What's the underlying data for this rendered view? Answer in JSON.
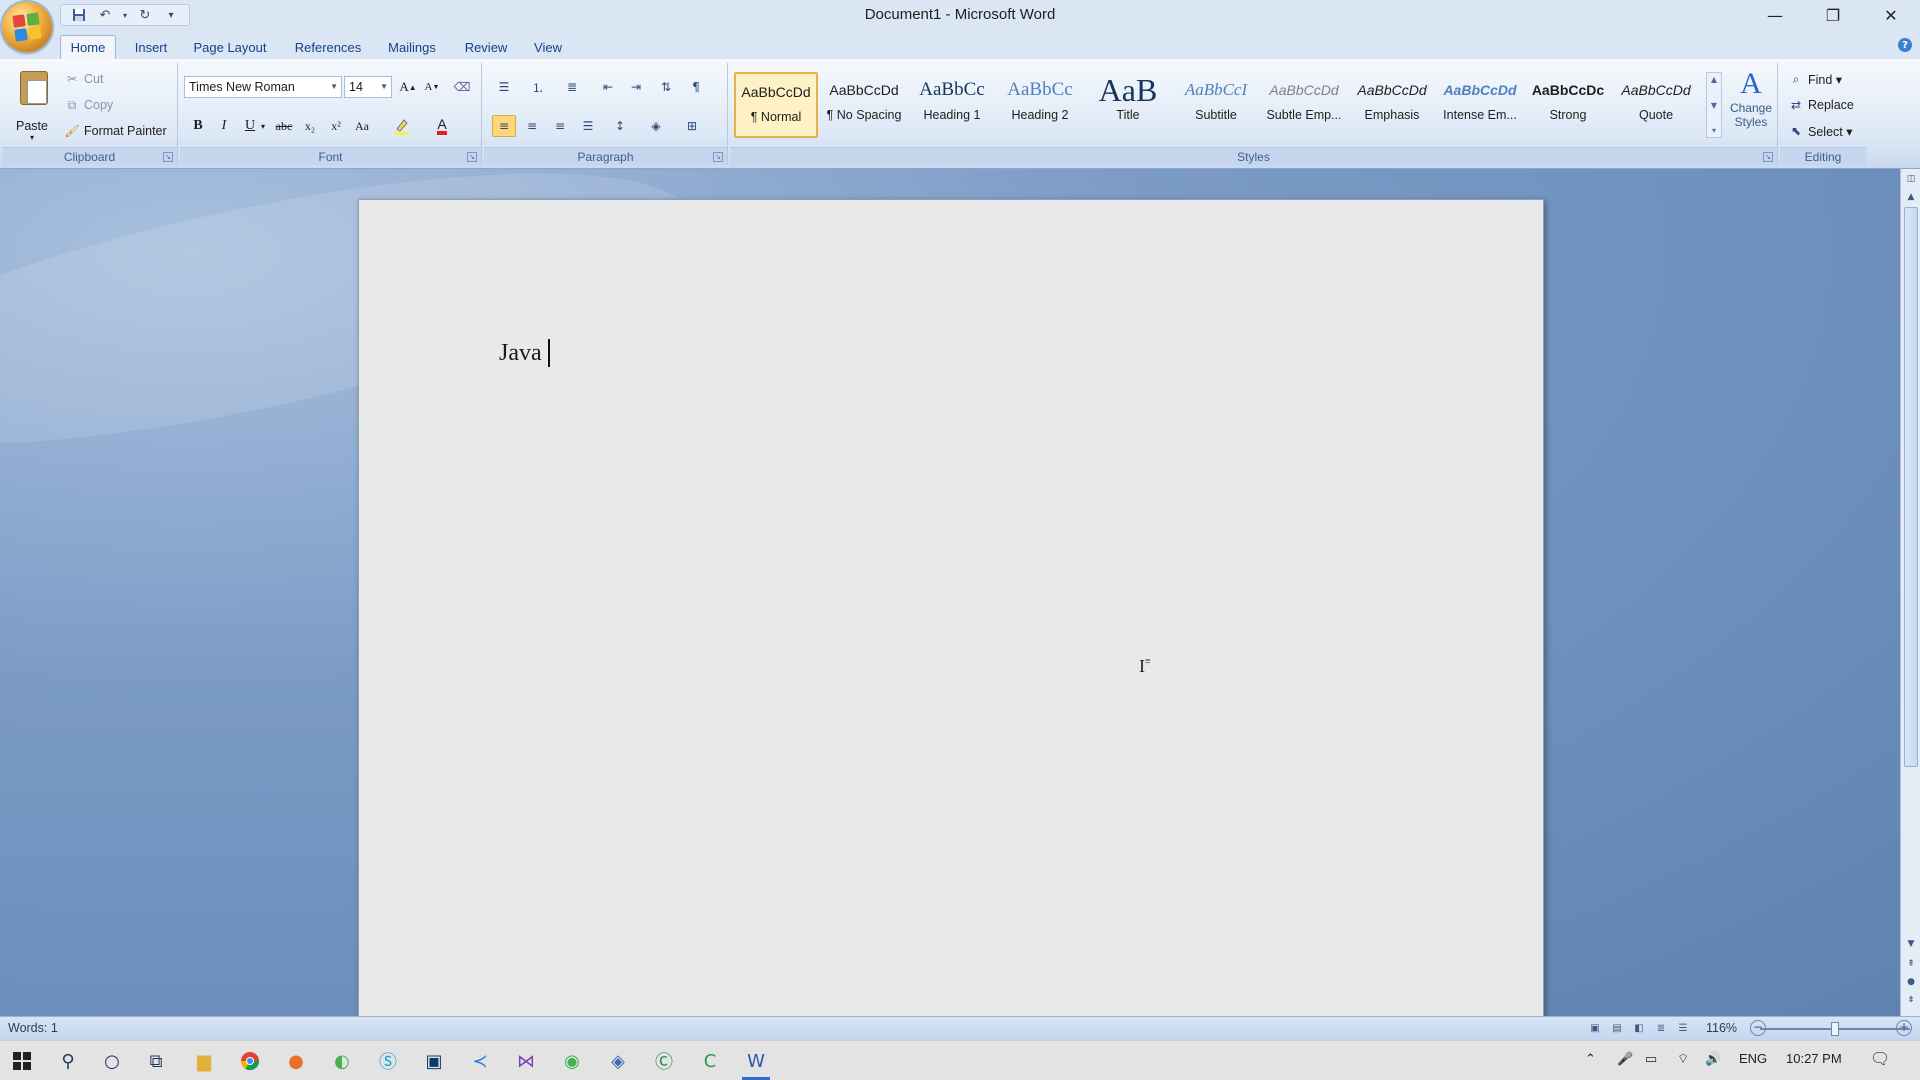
{
  "window": {
    "title": "Document1 - Microsoft Word",
    "controls": {
      "minimize": "—",
      "restore": "❐",
      "close": "✕"
    }
  },
  "quick_access": [
    "save-icon",
    "undo-icon",
    "redo-icon",
    "customize-icon"
  ],
  "tabs": [
    {
      "label": "Home",
      "active": true
    },
    {
      "label": "Insert"
    },
    {
      "label": "Page Layout"
    },
    {
      "label": "References"
    },
    {
      "label": "Mailings"
    },
    {
      "label": "Review"
    },
    {
      "label": "View"
    }
  ],
  "ribbon": {
    "clipboard": {
      "label": "Clipboard",
      "paste": "Paste",
      "cut": "Cut",
      "copy": "Copy",
      "format_painter": "Format Painter"
    },
    "font": {
      "label": "Font",
      "family": "Times New Roman",
      "size": "14",
      "buttons": [
        "B",
        "I",
        "U",
        "abc",
        "x₂",
        "x²",
        "Aa"
      ]
    },
    "paragraph": {
      "label": "Paragraph"
    },
    "styles": {
      "label": "Styles",
      "items": [
        {
          "sample": "AaBbCcDd",
          "name": "¶ Normal",
          "active": true
        },
        {
          "sample": "AaBbCcDd",
          "name": "¶ No Spacing"
        },
        {
          "sample": "AaBbCc",
          "name": "Heading 1"
        },
        {
          "sample": "AaBbCc",
          "name": "Heading 2"
        },
        {
          "sample": "AaB",
          "name": "Title"
        },
        {
          "sample": "AaBbCcI",
          "name": "Subtitle"
        },
        {
          "sample": "AaBbCcDd",
          "name": "Subtle Emp..."
        },
        {
          "sample": "AaBbCcDd",
          "name": "Emphasis"
        },
        {
          "sample": "AaBbCcDd",
          "name": "Intense Em..."
        },
        {
          "sample": "AaBbCcDc",
          "name": "Strong"
        },
        {
          "sample": "AaBbCcDd",
          "name": "Quote"
        }
      ],
      "change_styles_line1": "Change",
      "change_styles_line2": "Styles"
    },
    "editing": {
      "label": "Editing",
      "find": "Find",
      "replace": "Replace",
      "select": "Select"
    }
  },
  "document": {
    "text": "Java"
  },
  "status": {
    "words": "Words: 1",
    "zoom": "116%"
  },
  "taskbar": {
    "lang": "ENG",
    "time": "10:27 PM"
  },
  "colors": {
    "accent": "#2f6fd1",
    "highlight": "#fbd67a",
    "font_color": "#e02020"
  }
}
